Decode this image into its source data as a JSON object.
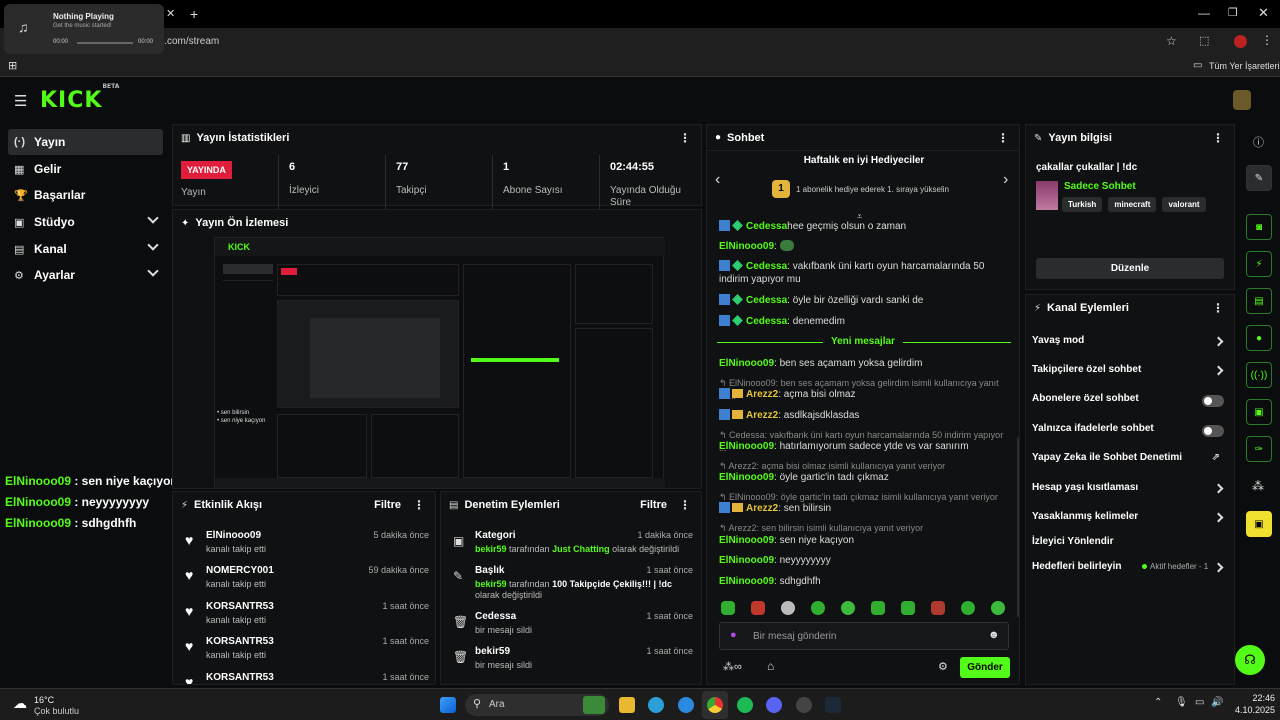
{
  "browser": {
    "media_title": "Nothing Playing",
    "media_subtitle": "Get the music started!",
    "media_time_start": "00:00",
    "media_time_end": "00:00",
    "url": "ick.com/stream",
    "bookmarks_label": "Tüm Yer İşaretleri"
  },
  "app": {
    "logo": "KICK",
    "logo_sup": "BETA"
  },
  "sidebar": {
    "items": [
      {
        "label": "Yayın",
        "icon": "(·)"
      },
      {
        "label": "Gelir",
        "icon": "▦"
      },
      {
        "label": "Başarılar",
        "icon": "🏆"
      },
      {
        "label": "Stüdyo",
        "icon": "▣"
      },
      {
        "label": "Kanal",
        "icon": "▤"
      },
      {
        "label": "Ayarlar",
        "icon": "⚙"
      }
    ],
    "chat_overlay": [
      {
        "user": "ElNinooo09",
        "msg": " : sen niye kaçıyon"
      },
      {
        "user": "ElNinooo09",
        "msg": " : neyyyyyyyy"
      },
      {
        "user": "ElNinooo09",
        "msg": " : sdhgdhfh"
      }
    ]
  },
  "stats": {
    "title": "Yayın İstatistikleri",
    "live_badge": "YAYINDA",
    "live_label": "Yayın",
    "viewers_value": "6",
    "viewers_label": "İzleyici",
    "followers_value": "77",
    "followers_label": "Takipçi",
    "subs_value": "1",
    "subs_label": "Abone Sayısı",
    "duration_value": "02:44:55",
    "duration_label": "Yayında Olduğu Süre"
  },
  "preview": {
    "title": "Yayın Ön İzlemesi"
  },
  "activity": {
    "title": "Etkinlik Akışı",
    "filter": "Filtre",
    "rows": [
      {
        "name": "ElNinooo09",
        "sub": "kanalı takip etti",
        "time": "5 dakika önce"
      },
      {
        "name": "NOMERCY001",
        "sub": "kanalı takip etti",
        "time": "59 dakika önce"
      },
      {
        "name": "KORSANTR53",
        "sub": "kanalı takip etti",
        "time": "1 saat önce"
      },
      {
        "name": "KORSANTR53",
        "sub": "kanalı takip etti",
        "time": "1 saat önce"
      },
      {
        "name": "KORSANTR53",
        "sub": "",
        "time": "1 saat önce"
      }
    ]
  },
  "moderation": {
    "title": "Denetim Eylemleri",
    "filter": "Filtre",
    "rows": [
      {
        "head": "Kategori",
        "time": "1 dakika önce",
        "u": "bekir59",
        "a": " tarafından ",
        "v": "Just Chatting",
        "b": " olarak değiştirildi"
      },
      {
        "head": "Başlık",
        "time": "1 saat önce",
        "u": "bekir59",
        "a": " tarafından ",
        "v": "100 Takipçide Çekiliş!!! | !dc",
        "b": " olarak değiştirildi"
      },
      {
        "head": "Cedessa",
        "time": "1 saat önce",
        "desc": "bir mesajı sildi"
      },
      {
        "head": "bekir59",
        "time": "1 saat önce",
        "desc": "bir mesajı sildi"
      }
    ]
  },
  "chat": {
    "title": "Sohbet",
    "gifters_title": "Haftalık en iyi Hediyeciler",
    "gifters_rank": "1",
    "gifters_text": "1 abonelik hediye ederek 1. sıraya yükselin",
    "partial_line": "hee geçmiş olsun o zaman",
    "new_messages": "Yeni mesajlar",
    "input_placeholder": "Bir mesaj gönderin",
    "send": "Gönder",
    "messages": [
      {
        "user": "Cedessa",
        "text": ": vakıfbank üni kartı oyun harcamalarında 50 indirim yapıyor mu"
      },
      {
        "user": "Cedessa",
        "text": ": öyle bir özelliği vardı sanki de"
      },
      {
        "user": "Cedessa",
        "text": ": denemedim"
      },
      {
        "user": "ElNinooo09",
        "text": ": ben ses açamam yoksa gelirdim"
      },
      {
        "reply": "ElNinooo09: ben ses açamam yoksa gelirdim isimli kullanıcıya yanıt ve..."
      },
      {
        "user": "Arezz2",
        "text": ": açma bisi olmaz"
      },
      {
        "user": "Arezz2",
        "text": ": asdlkajsdklasdas"
      },
      {
        "reply": "Cedessa: vakıfbank üni kartı oyun harcamalarında 50 indirim yapıyor ..."
      },
      {
        "user": "ElNinooo09",
        "text": ": hatırlamıyorum sadece ytde vs var sanırım"
      },
      {
        "reply": "Arezz2: açma bisi olmaz isimli kullanıcıya yanıt veriyor"
      },
      {
        "user": "ElNinooo09",
        "text": ": öyle gartic'in tadı çıkmaz"
      },
      {
        "reply": "ElNinooo09: öyle gartic'in tadı çıkmaz isimli kullanıcıya yanıt veriyor"
      },
      {
        "user": "Arezz2",
        "text": ": sen bilirsin"
      },
      {
        "reply": "Arezz2: sen bilirsin isimli kullanıcıya yanıt veriyor"
      },
      {
        "user": "ElNinooo09",
        "text": ": sen niye kaçıyon"
      },
      {
        "user": "ElNinooo09",
        "text": ": neyyyyyyyy"
      },
      {
        "user": "ElNinooo09",
        "text": ": sdhgdhfh"
      },
      {
        "user": "ElNinooo09",
        "text": ":"
      }
    ]
  },
  "info": {
    "title": "Yayın bilgisi",
    "stream_title": "çakallar çukallar | !dc",
    "category": "Sadece Sohbet",
    "tags": [
      "Turkish",
      "minecraft",
      "valorant"
    ],
    "edit": "Düzenle"
  },
  "channel_actions": {
    "title": "Kanal Eylemleri",
    "items": [
      {
        "label": "Yavaş mod",
        "ctrl": "chevron"
      },
      {
        "label": "Takipçilere özel sohbet",
        "ctrl": "chevron"
      },
      {
        "label": "Abonelere özel sohbet",
        "ctrl": "toggle"
      },
      {
        "label": "Yalnızca ifadelerle sohbet",
        "ctrl": "toggle"
      },
      {
        "label": "Yapay Zeka ile Sohbet Denetimi",
        "ctrl": "external"
      },
      {
        "label": "Hesap yaşı kısıtlaması",
        "ctrl": "chevron"
      },
      {
        "label": "Yasaklanmış kelimeler",
        "ctrl": "chevron"
      },
      {
        "label": "İzleyici Yönlendir",
        "ctrl": "none"
      },
      {
        "label": "Hedefleri belirleyin",
        "ctrl": "chevron"
      }
    ],
    "goals_status": "Aktif hedefler - 1"
  },
  "taskbar": {
    "weather_temp": "16°C",
    "weather_desc": "Çok bulutlu",
    "search": "Ara",
    "time": "22:46",
    "date": "4.10.2025"
  },
  "colors": {
    "accent": "#53fc18",
    "live": "#e01e3c",
    "bg": "#0b0c0d",
    "panel": "#101112"
  }
}
